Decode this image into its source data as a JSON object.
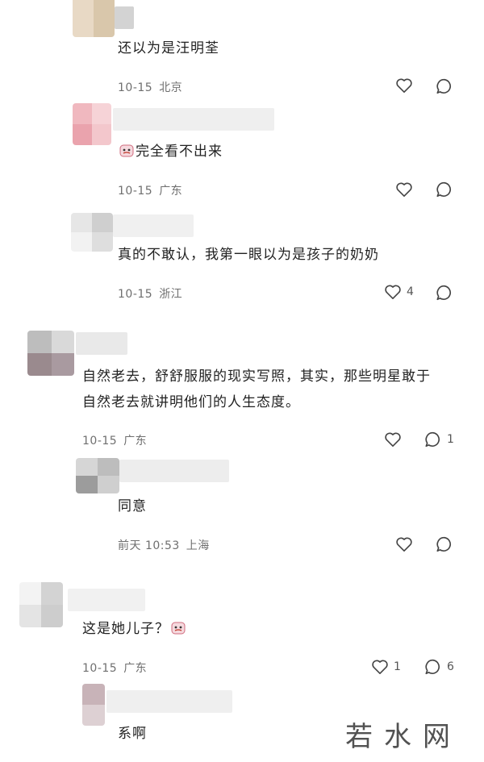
{
  "colors": {
    "background": "#ffffff",
    "meta_text": "#6f6f6f",
    "icon": "#444444",
    "emoji_accent": "#e0607a"
  },
  "comments": [
    {
      "text": "还以为是汪明荃",
      "date": "10-15",
      "location": "北京",
      "likes": "",
      "replies": "",
      "emoji": ""
    },
    {
      "text": "完全看不出来",
      "date": "10-15",
      "location": "广东",
      "likes": "",
      "replies": "",
      "emoji": "face-emoji"
    },
    {
      "text": "真的不敢认，我第一眼以为是孩子的奶奶",
      "date": "10-15",
      "location": "浙江",
      "likes": "4",
      "replies": "",
      "emoji": ""
    },
    {
      "text": "自然老去，舒舒服服的现实写照，其实，那些明星敢于自然老去就讲明他们的人生态度。",
      "date": "10-15",
      "location": "广东",
      "likes": "",
      "replies": "1",
      "emoji": ""
    },
    {
      "text": "同意",
      "date": "前天 10:53",
      "location": "上海",
      "likes": "",
      "replies": "",
      "emoji": ""
    },
    {
      "text": "这是她儿子？",
      "date": "10-15",
      "location": "广东",
      "likes": "1",
      "replies": "6",
      "emoji": "face-emoji"
    },
    {
      "text": "系啊",
      "date": "",
      "location": "",
      "likes": "",
      "replies": "",
      "emoji": ""
    }
  ],
  "watermark": {
    "text": "若水网"
  }
}
